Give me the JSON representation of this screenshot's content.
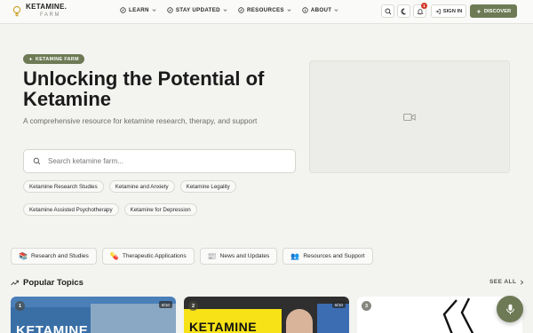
{
  "brand": {
    "name": "KETAMINE.",
    "sub": "FARM"
  },
  "nav": [
    {
      "label": "LEARN",
      "icon": "compass-icon"
    },
    {
      "label": "STAY UPDATED",
      "icon": "bell-icon"
    },
    {
      "label": "RESOURCES",
      "icon": "compass-icon"
    },
    {
      "label": "ABOUT",
      "icon": "info-icon"
    }
  ],
  "header": {
    "notification_count": "1",
    "signin_label": "SIGN IN",
    "discover_label": "DISCOVER"
  },
  "hero": {
    "badge": "KETAMINE FARM",
    "title": "Unlocking the Potential of Ketamine",
    "subtitle": "A comprehensive resource for ketamine research, therapy, and support",
    "search_placeholder": "Search ketamine farm...",
    "chips": [
      "Ketamine Research Studies",
      "Ketamine and Anxiety",
      "Ketamine Legality",
      "Ketamine Assisted Psychotherapy",
      "Ketamine for Depression"
    ]
  },
  "categories": [
    {
      "label": "Research and Studies",
      "emoji": "📚"
    },
    {
      "label": "Therapeutic Applications",
      "emoji": "💊"
    },
    {
      "label": "News and Updates",
      "emoji": "📰"
    },
    {
      "label": "Resources and Support",
      "emoji": "👥"
    }
  ],
  "popular": {
    "title": "Popular Topics",
    "see_all": "SEE ALL",
    "cards": [
      {
        "number": "1",
        "score": "8/10",
        "thumb_text": "KETAMINE"
      },
      {
        "number": "2",
        "score": "8/10",
        "thumb_text": "KETAMINE"
      },
      {
        "number": "3"
      }
    ]
  },
  "colors": {
    "accent": "#6e7a55",
    "badge": "#d33a2c",
    "background": "#f3f3f0"
  }
}
